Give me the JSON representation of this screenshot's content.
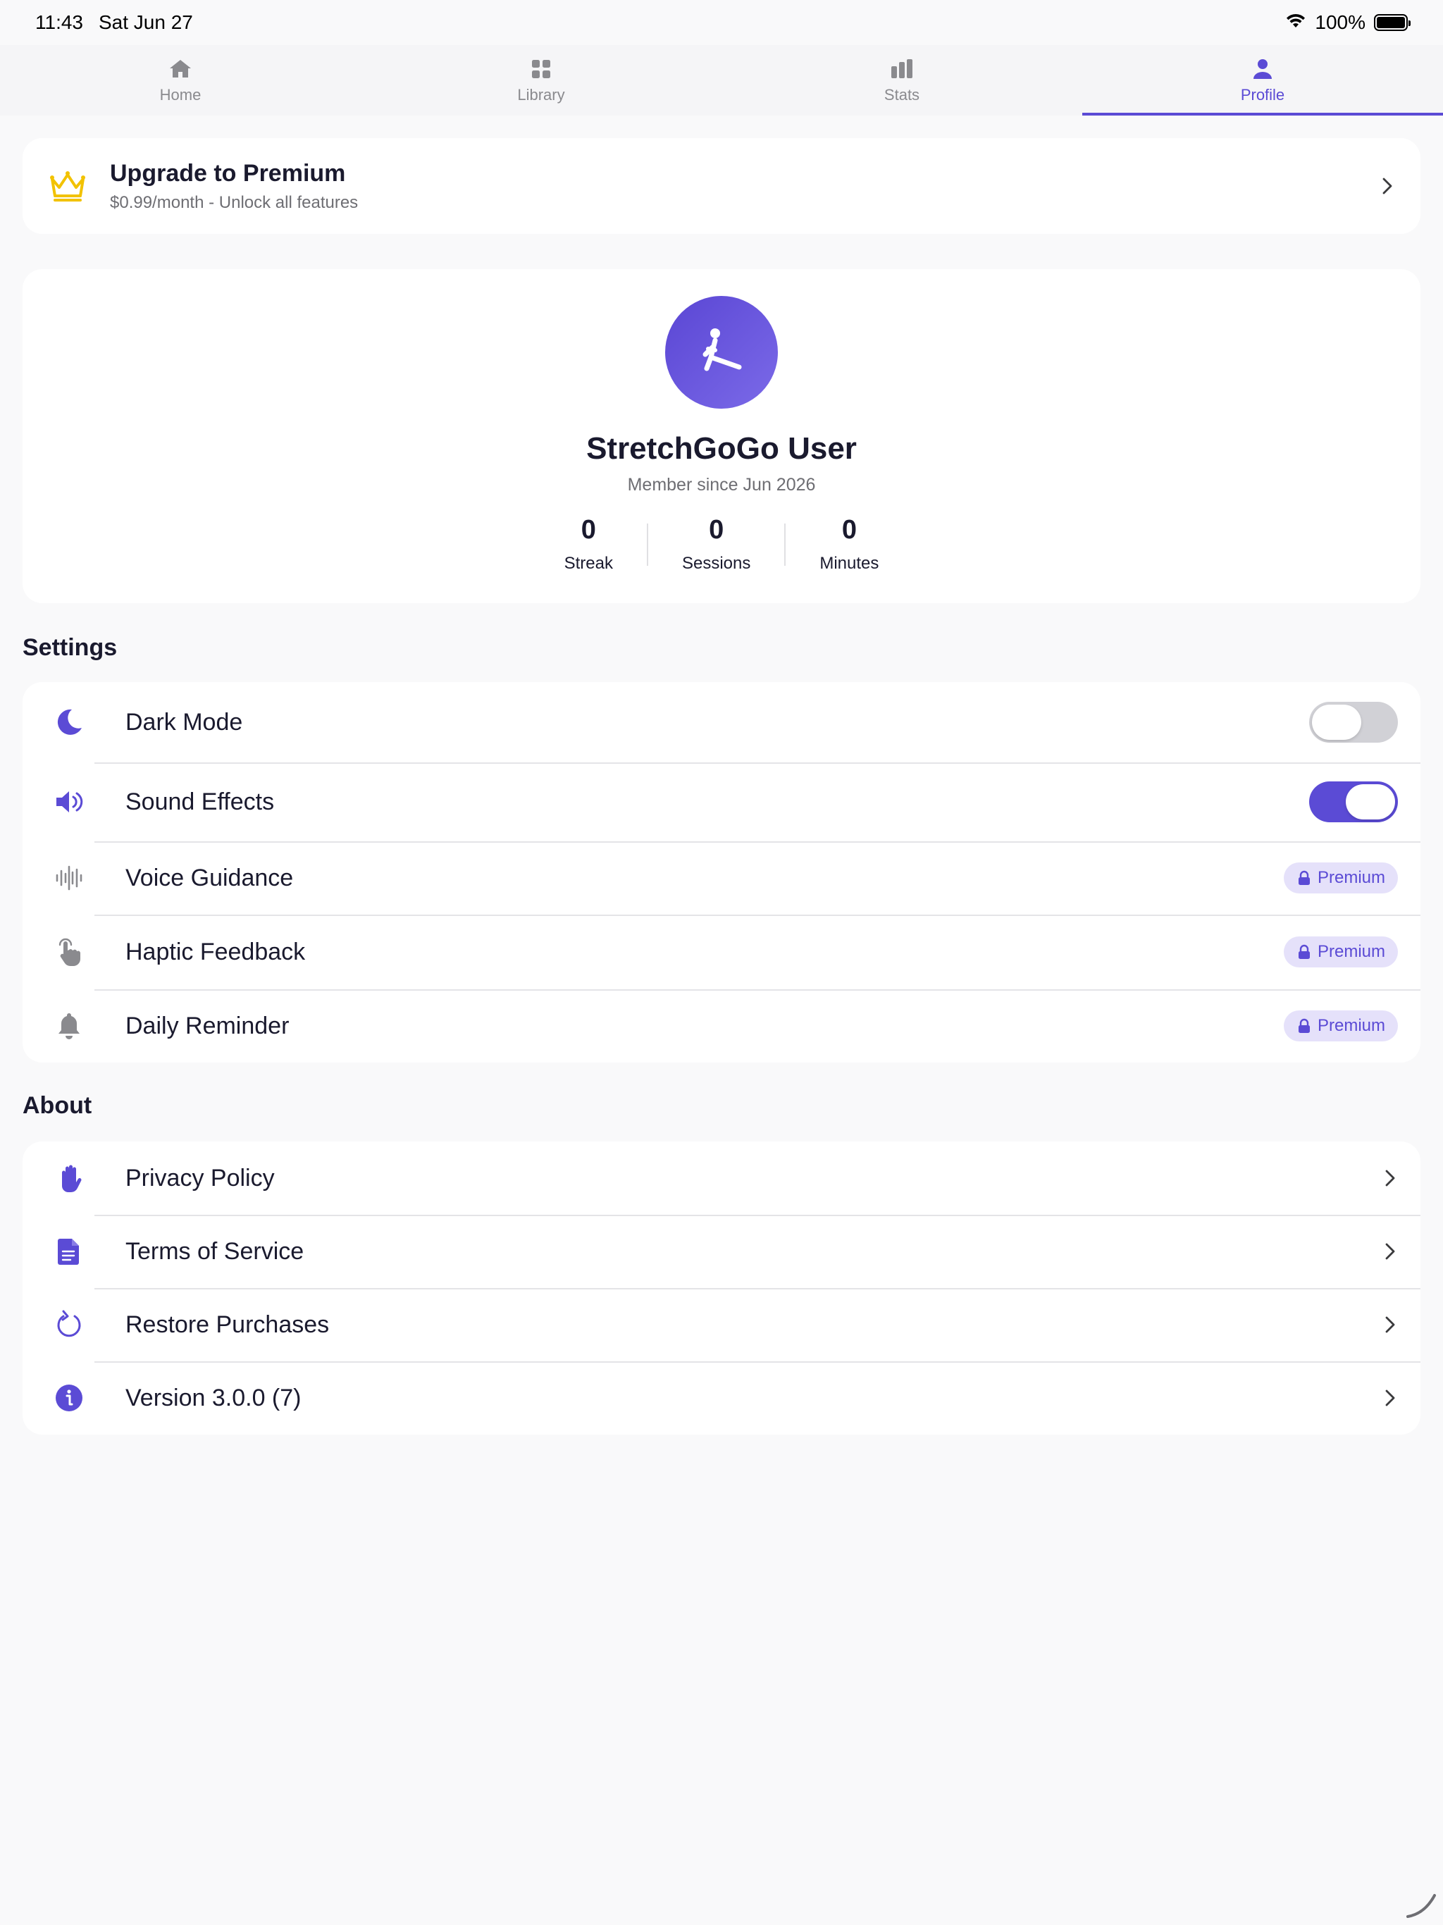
{
  "status_bar": {
    "time": "11:43",
    "date": "Sat Jun 27",
    "battery_percent": "100%",
    "battery_level": 1.0
  },
  "tabs": [
    {
      "label": "Home",
      "icon": "home-icon",
      "active": false
    },
    {
      "label": "Library",
      "icon": "grid-icon",
      "active": false
    },
    {
      "label": "Stats",
      "icon": "bar-chart-icon",
      "active": false
    },
    {
      "label": "Profile",
      "icon": "person-icon",
      "active": true
    }
  ],
  "upgrade": {
    "title": "Upgrade to Premium",
    "subtitle": "$0.99/month - Unlock all features",
    "icon": "crown-icon"
  },
  "profile": {
    "name": "StretchGoGo User",
    "member_since": "Member since Jun 2026",
    "avatar_icon": "stretching-person-icon",
    "stats": [
      {
        "value": "0",
        "label": "Streak"
      },
      {
        "value": "0",
        "label": "Sessions"
      },
      {
        "value": "0",
        "label": "Minutes"
      }
    ]
  },
  "settings": {
    "title": "Settings",
    "items": [
      {
        "label": "Dark Mode",
        "icon": "moon-icon",
        "control": "toggle",
        "on": false
      },
      {
        "label": "Sound Effects",
        "icon": "speaker-icon",
        "control": "toggle",
        "on": true
      },
      {
        "label": "Voice Guidance",
        "icon": "waveform-icon",
        "control": "premium",
        "badge": "Premium"
      },
      {
        "label": "Haptic Feedback",
        "icon": "hand-tap-icon",
        "control": "premium",
        "badge": "Premium"
      },
      {
        "label": "Daily Reminder",
        "icon": "bell-icon",
        "control": "premium",
        "badge": "Premium"
      }
    ]
  },
  "about": {
    "title": "About",
    "items": [
      {
        "label": "Privacy Policy",
        "icon": "hand-raised-icon"
      },
      {
        "label": "Terms of Service",
        "icon": "document-icon"
      },
      {
        "label": "Restore Purchases",
        "icon": "refresh-icon"
      },
      {
        "label": "Version 3.0.0 (7)",
        "icon": "info-icon"
      }
    ]
  },
  "colors": {
    "accent": "#5b4bd5",
    "crown": "#f2c200",
    "inactive_icon": "#8a8a8e",
    "premium_badge_bg": "#e5e1fa"
  }
}
